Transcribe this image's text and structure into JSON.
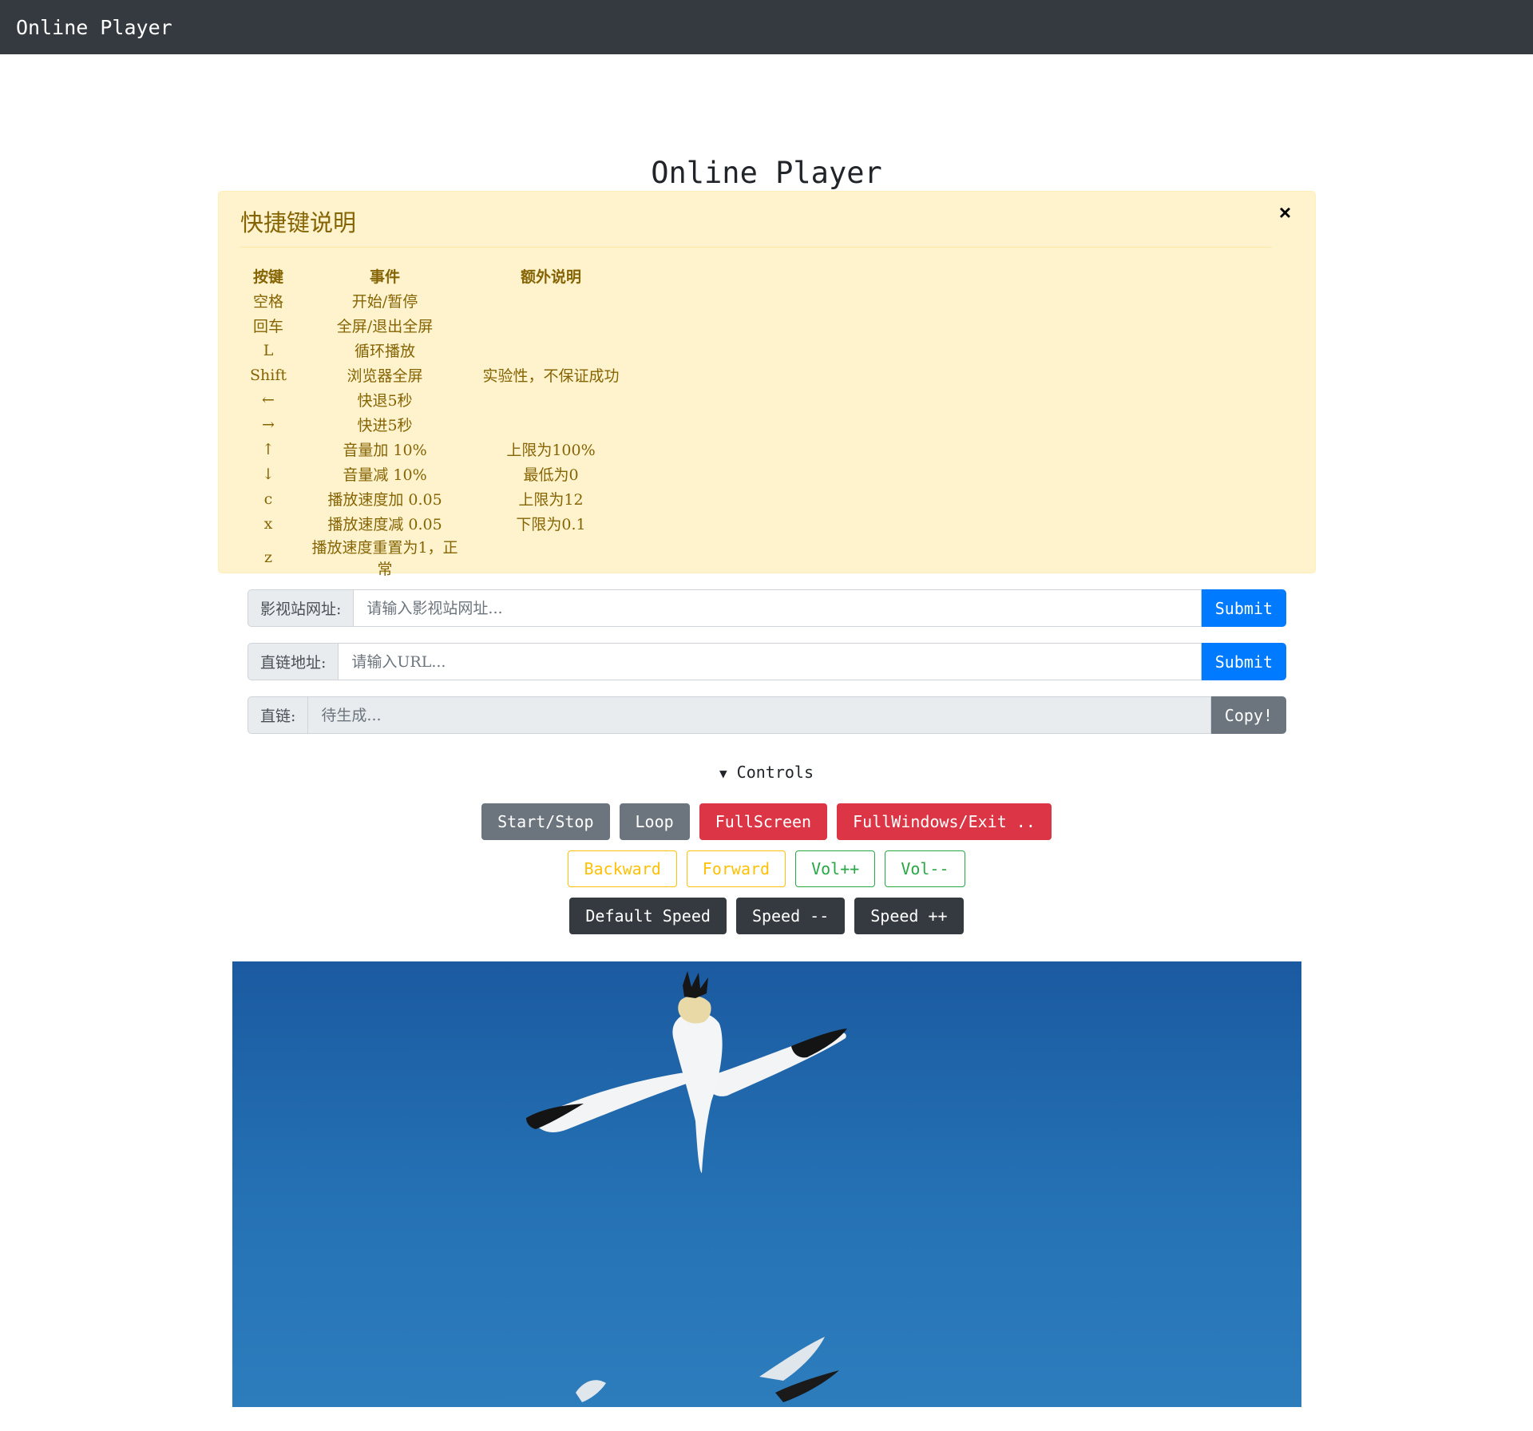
{
  "navbar": {
    "brand": "Online Player"
  },
  "page": {
    "title": "Online Player"
  },
  "shortcuts": {
    "heading": "快捷键说明",
    "close_label": "×",
    "headers": {
      "key": "按键",
      "event": "事件",
      "note": "额外说明"
    },
    "rows": [
      {
        "key": "空格",
        "event": "开始/暂停",
        "note": ""
      },
      {
        "key": "回车",
        "event": "全屏/退出全屏",
        "note": ""
      },
      {
        "key": "L",
        "event": "循环播放",
        "note": ""
      },
      {
        "key": "Shift",
        "event": "浏览器全屏",
        "note": "实验性，不保证成功"
      },
      {
        "key": "←",
        "event": "快退5秒",
        "note": ""
      },
      {
        "key": "→",
        "event": "快进5秒",
        "note": ""
      },
      {
        "key": "↑",
        "event": "音量加 10%",
        "note": "上限为100%"
      },
      {
        "key": "↓",
        "event": "音量减 10%",
        "note": "最低为0"
      },
      {
        "key": "c",
        "event": "播放速度加 0.05",
        "note": "上限为12"
      },
      {
        "key": "x",
        "event": "播放速度减 0.05",
        "note": "下限为0.1"
      },
      {
        "key": "z",
        "event": "播放速度重置为1，正常",
        "note": ""
      }
    ]
  },
  "site_form": {
    "label": "影视站网址:",
    "placeholder": "请输入影视站网址...",
    "submit": "Submit"
  },
  "url_form": {
    "label": "直链地址:",
    "placeholder": "请输入URL...",
    "submit": "Submit"
  },
  "link_form": {
    "label": "直链:",
    "placeholder": "待生成...",
    "copy": "Copy!"
  },
  "controls": {
    "summary": "Controls",
    "row1": {
      "start_stop": "Start/Stop",
      "loop": "Loop",
      "fullscreen": "FullScreen",
      "fullwindows": "FullWindows/Exit .."
    },
    "row2": {
      "backward": "Backward",
      "forward": "Forward",
      "vol_up": "Vol++",
      "vol_down": "Vol--"
    },
    "row3": {
      "default_speed": "Default Speed",
      "speed_down": "Speed --",
      "speed_up": "Speed ++"
    }
  },
  "colors": {
    "navbar": "#343a40",
    "alert_bg": "#fff3cd",
    "alert_text": "#856404",
    "primary": "#007bff",
    "secondary": "#6c757d",
    "danger": "#dc3545",
    "warning": "#ffc107",
    "success": "#28a745",
    "dark": "#343a40",
    "video_sky": "#1f62a8"
  }
}
